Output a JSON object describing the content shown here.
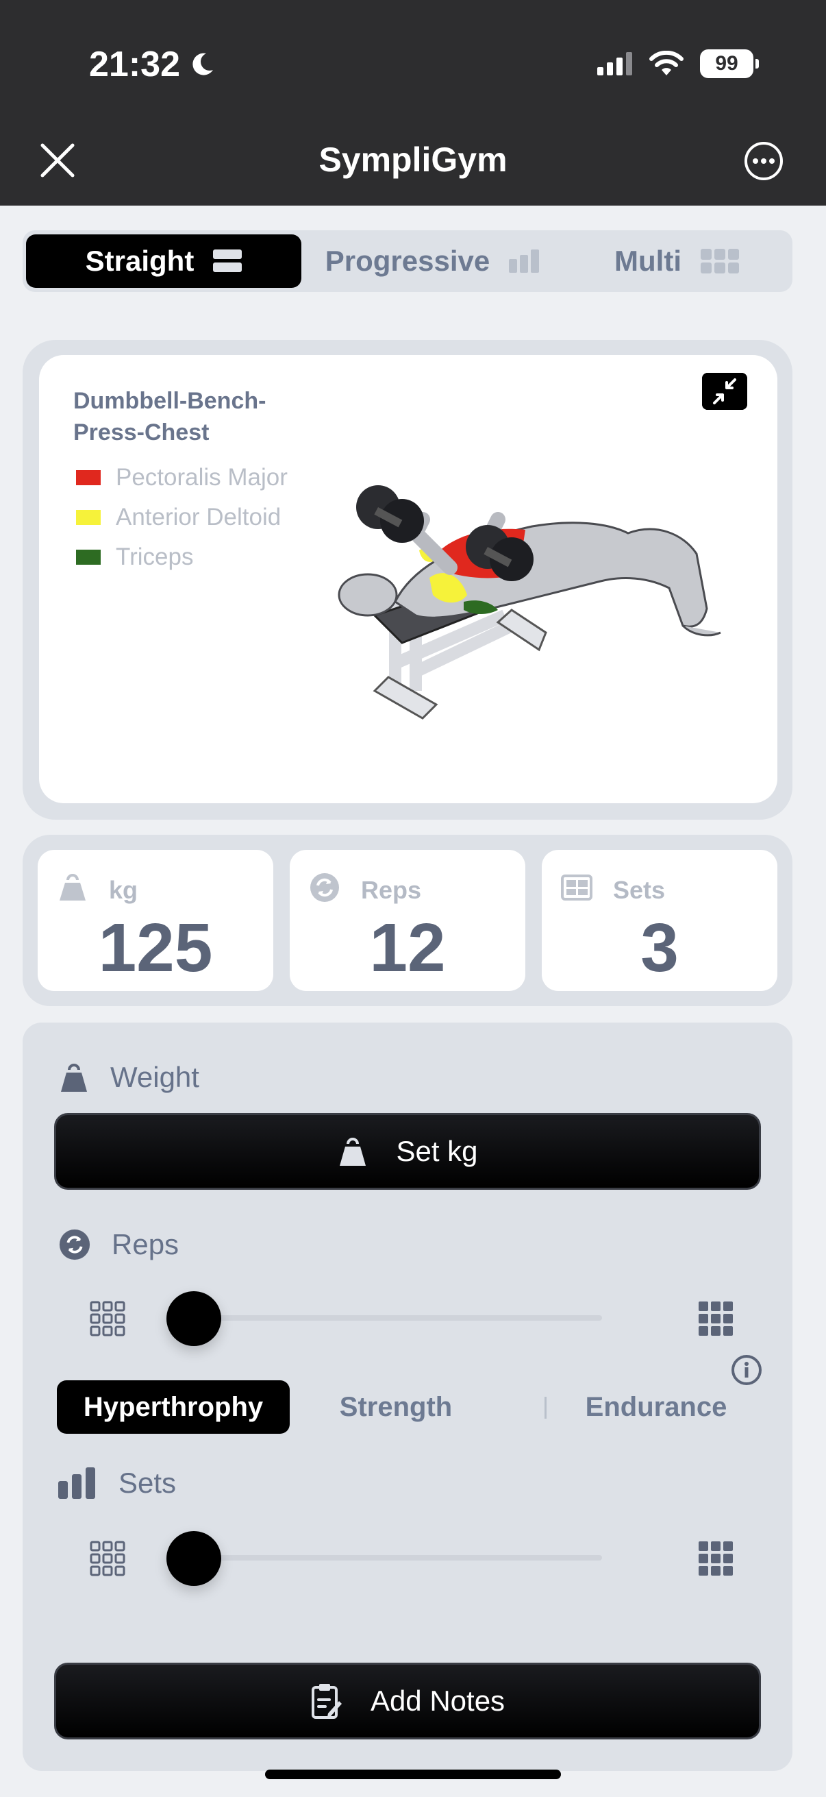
{
  "status_bar": {
    "time": "21:32",
    "battery": "99"
  },
  "header": {
    "title": "SympliGym"
  },
  "mode_tabs": [
    {
      "label": "Straight",
      "active": true
    },
    {
      "label": "Progressive",
      "active": false
    },
    {
      "label": "Multi",
      "active": false
    }
  ],
  "exercise": {
    "name": "Dumbbell-Bench-Press-Chest",
    "muscles": [
      {
        "label": "Pectoralis Major",
        "color": "#e0281e"
      },
      {
        "label": "Anterior Deltoid",
        "color": "#f6f23a"
      },
      {
        "label": "Triceps",
        "color": "#2d6b22"
      }
    ]
  },
  "stats": {
    "weight": {
      "label": "kg",
      "value": "125"
    },
    "reps": {
      "label": "Reps",
      "value": "12"
    },
    "sets": {
      "label": "Sets",
      "value": "3"
    }
  },
  "controls": {
    "weight_label": "Weight",
    "set_kg_label": "Set kg",
    "reps_label": "Reps",
    "training_types": [
      {
        "label": "Hyperthrophy",
        "active": true
      },
      {
        "label": "Strength",
        "active": false
      },
      {
        "label": "Endurance",
        "active": false
      }
    ],
    "sets_label": "Sets",
    "add_notes_label": "Add Notes"
  }
}
